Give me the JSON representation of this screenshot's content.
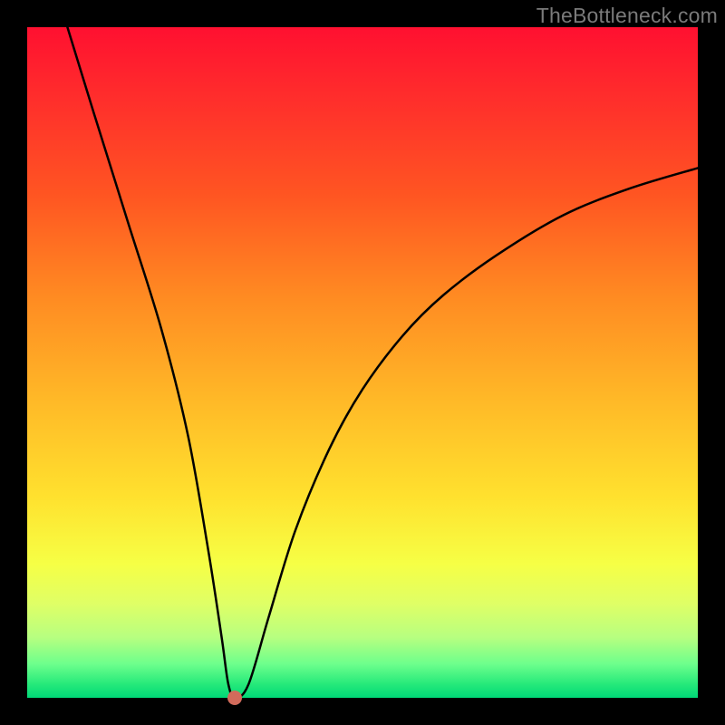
{
  "watermark": "TheBottleneck.com",
  "chart_data": {
    "type": "line",
    "title": "",
    "xlabel": "",
    "ylabel": "",
    "xlim": [
      0,
      100
    ],
    "ylim": [
      0,
      100
    ],
    "grid": false,
    "series": [
      {
        "name": "bottleneck-curve",
        "x": [
          6,
          10,
          15,
          20,
          24,
          27,
          29,
          30,
          31,
          33,
          36,
          40,
          45,
          50,
          56,
          62,
          70,
          80,
          90,
          100
        ],
        "values": [
          100,
          87,
          71,
          55,
          39,
          22,
          9,
          2,
          0,
          2,
          12,
          25,
          37,
          46,
          54,
          60,
          66,
          72,
          76,
          79
        ]
      }
    ],
    "annotations": [
      {
        "name": "optimal-point",
        "x": 31,
        "y": 0
      }
    ],
    "colors": {
      "top": "#ff1030",
      "bottom": "#00d877",
      "curve": "#000000",
      "dot": "#d26b5b"
    }
  }
}
